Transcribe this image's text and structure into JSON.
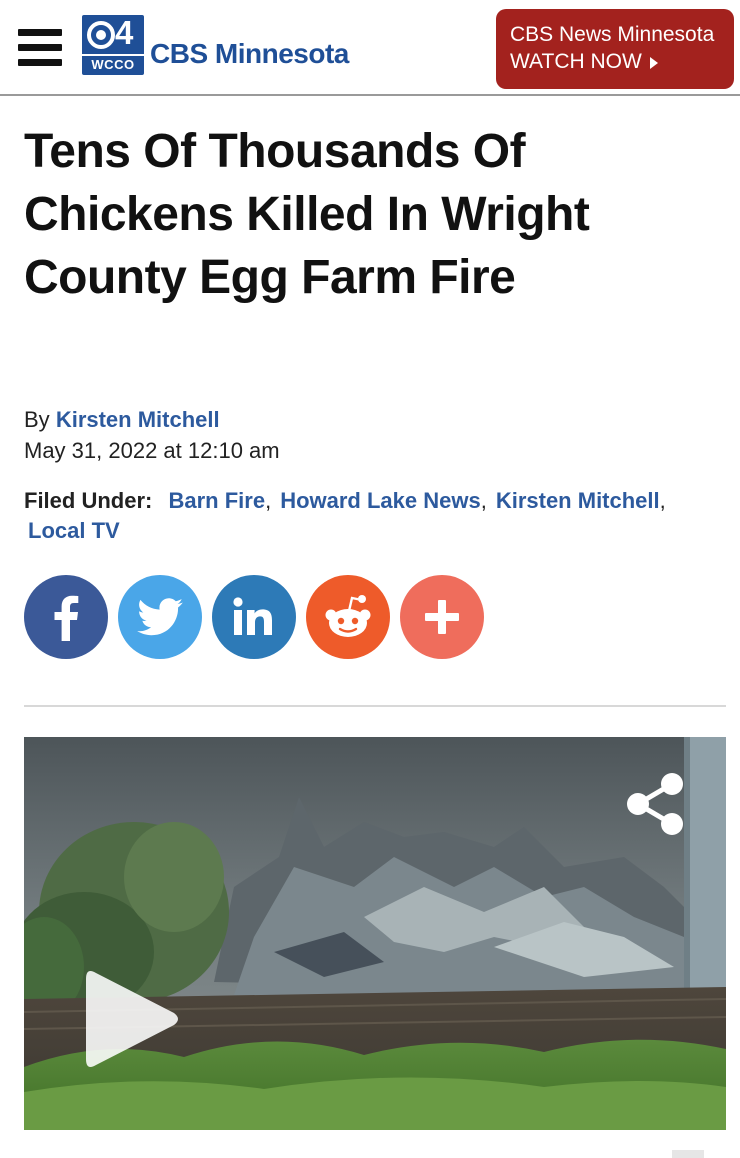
{
  "header": {
    "menu_icon": "hamburger-menu-icon",
    "logo": {
      "number": "4",
      "station": "WCCO",
      "brand": "CBS Minnesota"
    },
    "watch_button": {
      "line1": "CBS News Minnesota",
      "line2": "WATCH NOW",
      "icon": "caret-right-icon"
    }
  },
  "article": {
    "title": "Tens Of Thousands Of Chickens Killed In Wright County Egg Farm Fire",
    "byline_prefix": "By",
    "author": "Kirsten Mitchell",
    "date": "May 31, 2022 at 12:10 am",
    "filed_under_label": "Filed Under:",
    "tags": [
      "Barn Fire",
      "Howard Lake News",
      "Kirsten Mitchell",
      "Local TV"
    ]
  },
  "social": [
    {
      "name": "facebook",
      "icon": "facebook-icon",
      "color": "#3b5998"
    },
    {
      "name": "twitter",
      "icon": "twitter-icon",
      "color": "#4aa6e8"
    },
    {
      "name": "linkedin",
      "icon": "linkedin-icon",
      "color": "#2d7ab7"
    },
    {
      "name": "reddit",
      "icon": "reddit-icon",
      "color": "#ee5b2a"
    },
    {
      "name": "more",
      "icon": "plus-icon",
      "color": "#ef6d5c"
    }
  ],
  "video": {
    "share_icon": "share-icon",
    "play_icon": "play-icon"
  },
  "colors": {
    "brand_blue": "#1f4f97",
    "watch_red": "#a3221e",
    "link_blue": "#2d5a9e"
  }
}
